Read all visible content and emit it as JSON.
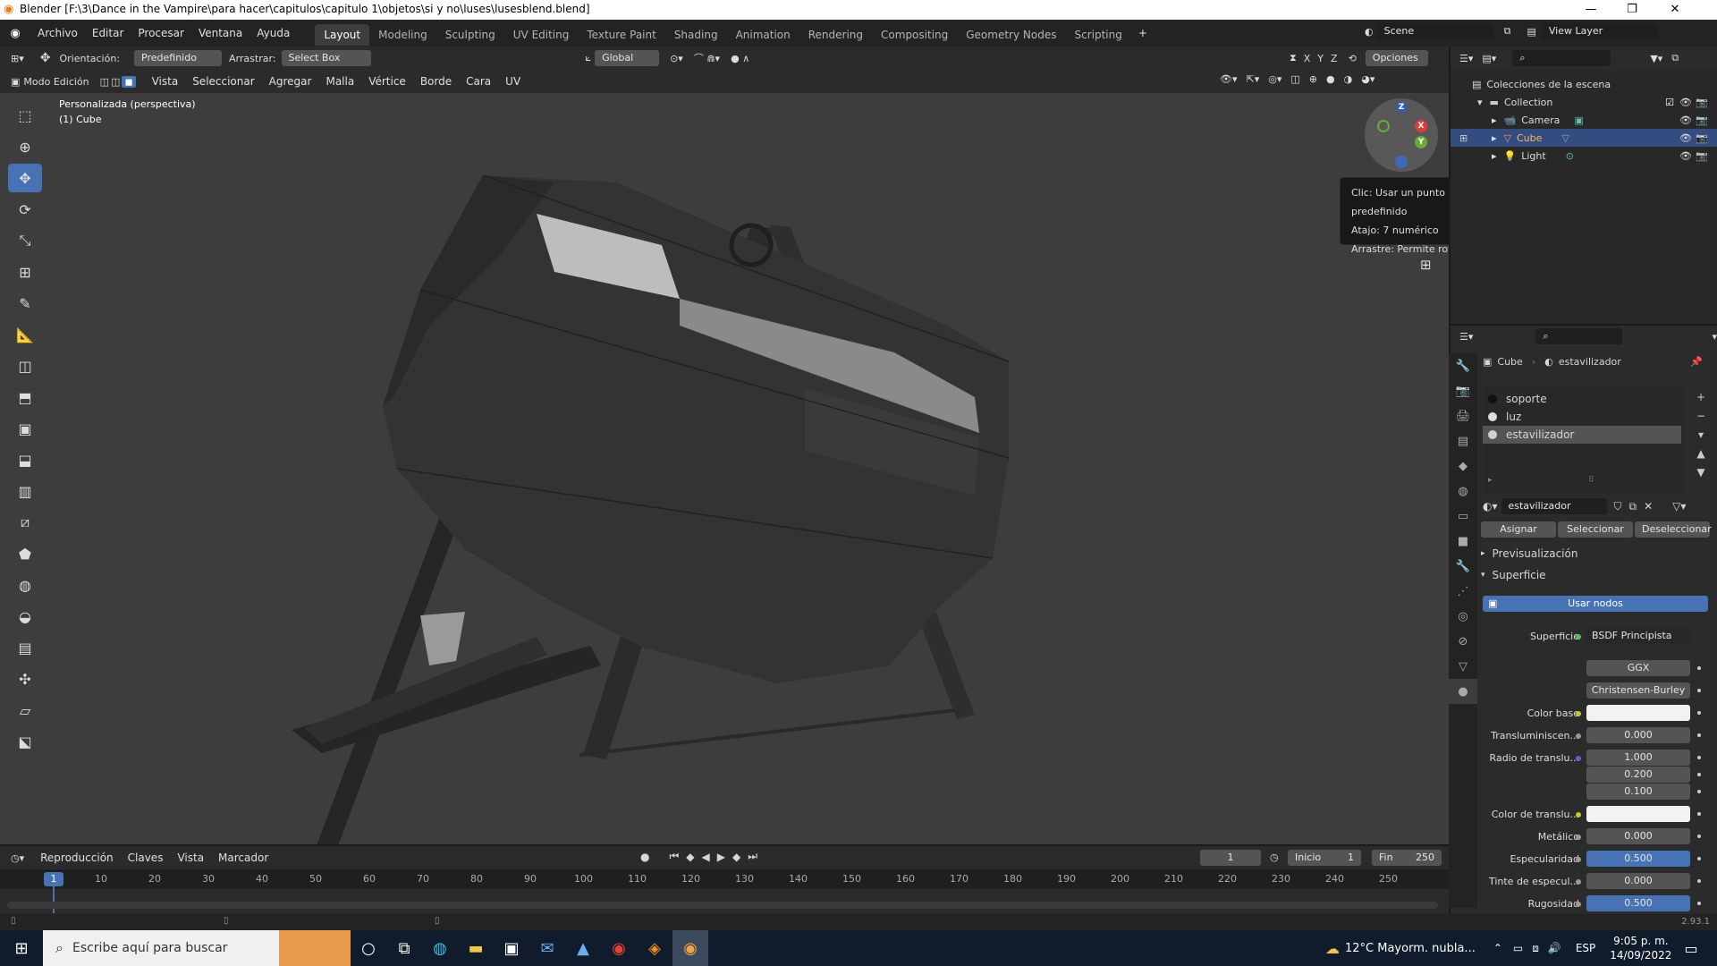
{
  "window": {
    "title": "Blender [F:\\3\\Dance in the Vampire\\para hacer\\capitulos\\capitulo 1\\objetos\\si y no\\luses\\lusesblend.blend]",
    "minimize": "—",
    "maximize": "❐",
    "close": "✕"
  },
  "menu": [
    "Archivo",
    "Editar",
    "Procesar",
    "Ventana",
    "Ayuda"
  ],
  "workspaces": [
    "Layout",
    "Modeling",
    "Sculpting",
    "UV Editing",
    "Texture Paint",
    "Shading",
    "Animation",
    "Rendering",
    "Compositing",
    "Geometry Nodes",
    "Scripting"
  ],
  "active_workspace": "Layout",
  "scene": {
    "label": "Scene",
    "view_layer": "View Layer"
  },
  "header1": {
    "orientation_label": "Orientación:",
    "orientation": "Predefinido",
    "drag_label": "Arrastrar:",
    "drag": "Select Box",
    "transform": "Global",
    "axes": [
      "X",
      "Y",
      "Z"
    ],
    "options": "Opciones"
  },
  "header2": {
    "mode": "Modo Edición",
    "menus": [
      "Vista",
      "Seleccionar",
      "Agregar",
      "Malla",
      "Vértice",
      "Borde",
      "Cara",
      "UV"
    ]
  },
  "viewport": {
    "view_name": "Personalizada (perspectiva)",
    "object": "(1) Cube"
  },
  "tooltip": {
    "line1": "Clic: Usar un punto de vista predefinido",
    "line2": "Atajo: 7 numérico",
    "line3": "Arrastre: Permite rotar la vista"
  },
  "gizmo": {
    "x": "X",
    "y": "Y",
    "z": "Z"
  },
  "outliner": {
    "root": "Colecciones de la escena",
    "collection": "Collection",
    "items": [
      {
        "name": "Camera"
      },
      {
        "name": "Cube"
      },
      {
        "name": "Light"
      }
    ]
  },
  "properties": {
    "breadcrumb_object": "Cube",
    "breadcrumb_material": "estavilizador",
    "slots": [
      "soporte",
      "luz",
      "estavilizador"
    ],
    "material_name": "estavilizador",
    "buttons": [
      "Asignar",
      "Seleccionar",
      "Deseleccionar"
    ],
    "section_preview": "Previsualización",
    "section_surface": "Superficie",
    "use_nodes": "Usar nodos",
    "surface_label": "Superficie",
    "surface_value": "BSDF Principista",
    "distribution": "GGX",
    "subsurface_method": "Christensen-Burley",
    "rows": [
      {
        "label": "Color base",
        "value": ""
      },
      {
        "label": "Transluminiscen...",
        "value": "0.000"
      },
      {
        "label": "Radio de translu...",
        "value": "1.000"
      },
      {
        "label": "",
        "value": "0.200"
      },
      {
        "label": "",
        "value": "0.100"
      },
      {
        "label": "Color de translu...",
        "value": ""
      },
      {
        "label": "Metálico",
        "value": "0.000"
      },
      {
        "label": "Especularidad",
        "value": "0.500"
      },
      {
        "label": "Tinte de especul...",
        "value": "0.000"
      },
      {
        "label": "Rugosidad",
        "value": "0.500"
      }
    ]
  },
  "timeline": {
    "menus": [
      "Reproducción",
      "Claves",
      "Vista",
      "Marcador"
    ],
    "current_frame": "1",
    "start_label": "Inicio",
    "start": "1",
    "end_label": "Fin",
    "end": "250",
    "ticks": [
      "10",
      "20",
      "30",
      "40",
      "50",
      "60",
      "70",
      "80",
      "90",
      "100",
      "110",
      "120",
      "130",
      "140",
      "150",
      "160",
      "170",
      "180",
      "190",
      "200",
      "210",
      "220",
      "230",
      "240",
      "250"
    ],
    "playhead": "1"
  },
  "status": {
    "version": "2.93.1"
  },
  "taskbar": {
    "search_placeholder": "Escribe aquí para buscar",
    "weather": "12°C  Mayorm. nubla...",
    "lang": "ESP",
    "time": "9:05 p. m.",
    "date": "14/09/2022"
  }
}
